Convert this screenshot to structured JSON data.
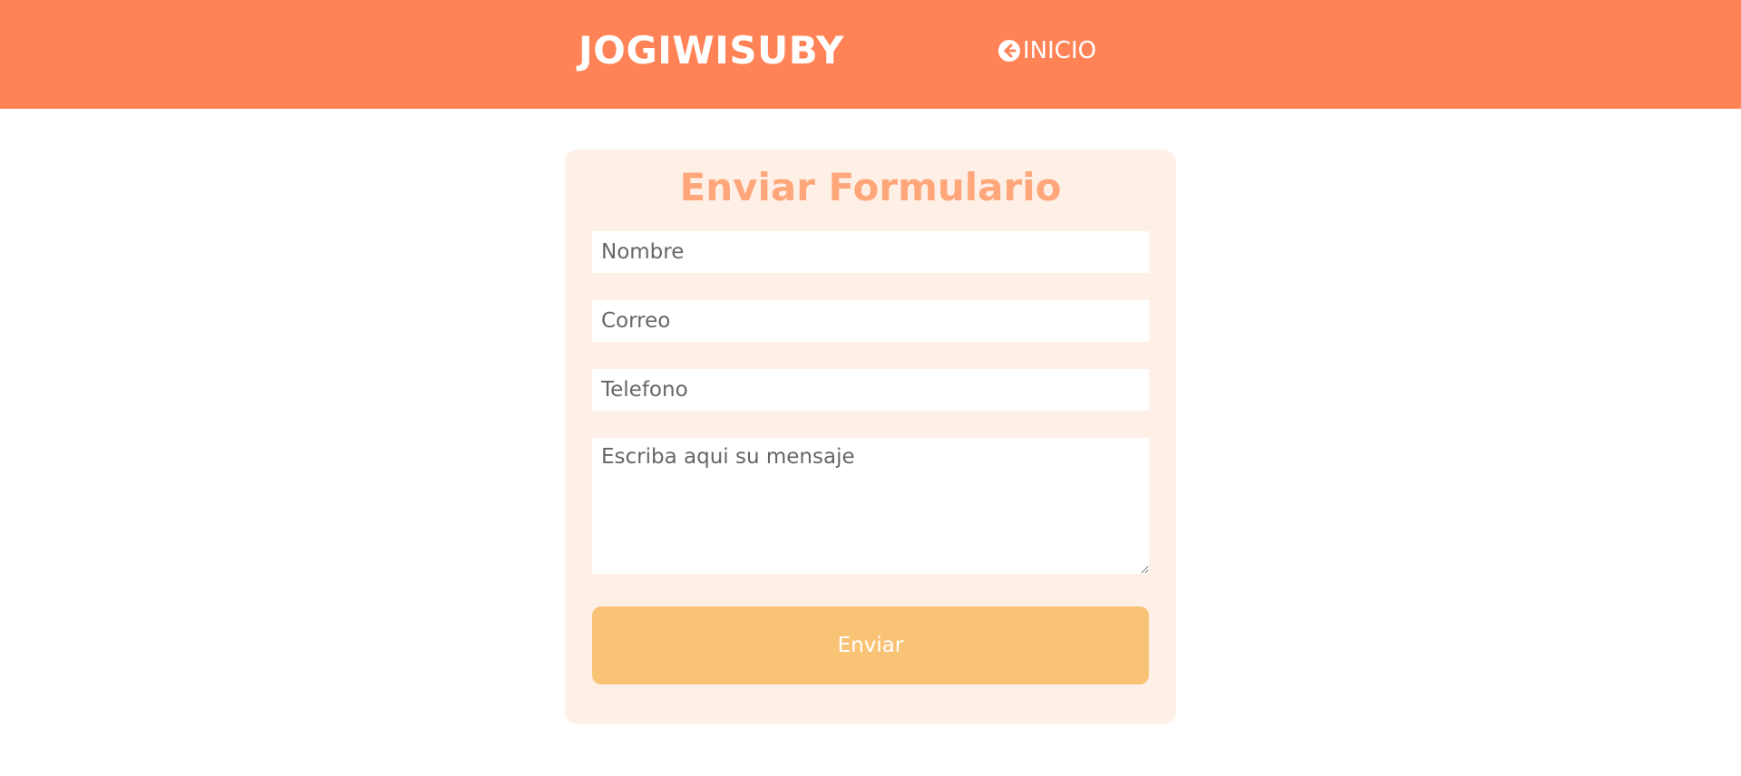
{
  "header": {
    "brand": "JOGIWISUBY",
    "nav_label": "INICIO",
    "nav_icon": "arrow-left-circle-icon"
  },
  "form": {
    "title": "Enviar Formulario",
    "name_placeholder": "Nombre",
    "email_placeholder": "Correo",
    "phone_placeholder": "Telefono",
    "message_placeholder": "Escriba aqui su mensaje",
    "submit_label": "Enviar"
  },
  "colors": {
    "header_bg": "#ff8356",
    "card_bg": "#fef0e7",
    "title": "#ffa77a",
    "button": "#f9c376"
  }
}
